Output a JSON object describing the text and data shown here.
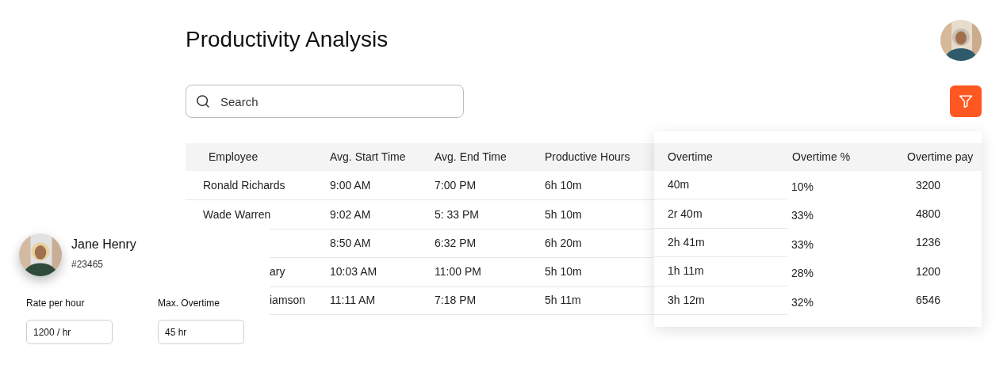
{
  "title": "Productivity Analysis",
  "search": {
    "placeholder": "Search"
  },
  "table": {
    "columns": [
      "Employee",
      "Avg. Start Time",
      "Avg. End Time",
      "Productive Hours",
      "Overtime",
      "Overtime %",
      "Overtime pay"
    ],
    "rows": [
      {
        "cut": false,
        "cells": [
          "Ronald Richards",
          "9:00 AM",
          "7:00 PM",
          "6h 10m",
          "40m",
          "10%",
          "3200"
        ]
      },
      {
        "cut": false,
        "cells": [
          "Wade Warren",
          "9:02 AM",
          "5: 33 PM",
          "5h 10m",
          "2r 40m",
          "33%",
          "4800"
        ]
      },
      {
        "cut": true,
        "cells": [
          "",
          "8:50 AM",
          "6:32 PM",
          "6h 20m",
          "2h 41m",
          "33%",
          "1236"
        ]
      },
      {
        "cut": true,
        "cells": [
          "ary",
          "10:03 AM",
          "11:00 PM",
          "5h 10m",
          "1h 11m",
          "28%",
          "1200"
        ]
      },
      {
        "cut": true,
        "cells": [
          "iamson",
          "11:11 AM",
          "7:18 PM",
          "5h 11m",
          "3h 12m",
          "32%",
          "6546"
        ]
      }
    ]
  },
  "profile": {
    "name": "Jane Henry",
    "id": "#23465",
    "fields": [
      {
        "label": "Rate per hour",
        "value": "1200 / hr"
      },
      {
        "label": "Max. Overtime",
        "value": "45 hr"
      }
    ]
  }
}
